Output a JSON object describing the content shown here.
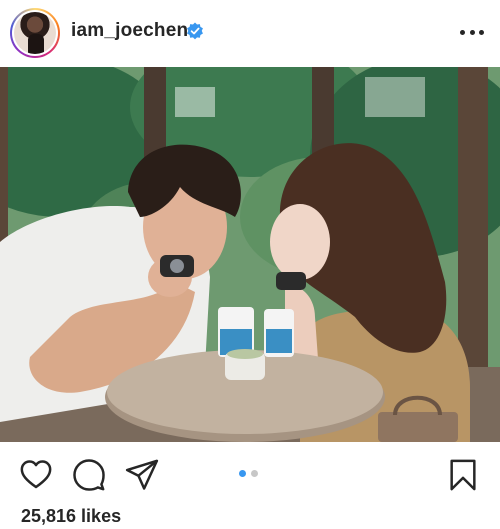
{
  "post": {
    "username": "iam_joechen",
    "likes_text": "25,816 likes",
    "carousel": {
      "total": 2,
      "active": 1
    }
  },
  "icons": {
    "verified": "verified-badge-icon",
    "more": "more-options-icon",
    "like": "heart-icon",
    "comment": "comment-icon",
    "share": "paper-plane-icon",
    "save": "bookmark-icon"
  },
  "colors": {
    "verified_blue": "#3897f0",
    "text": "#262626",
    "carousel_active": "#3897f0",
    "carousel_inactive": "#c7c7c7"
  }
}
